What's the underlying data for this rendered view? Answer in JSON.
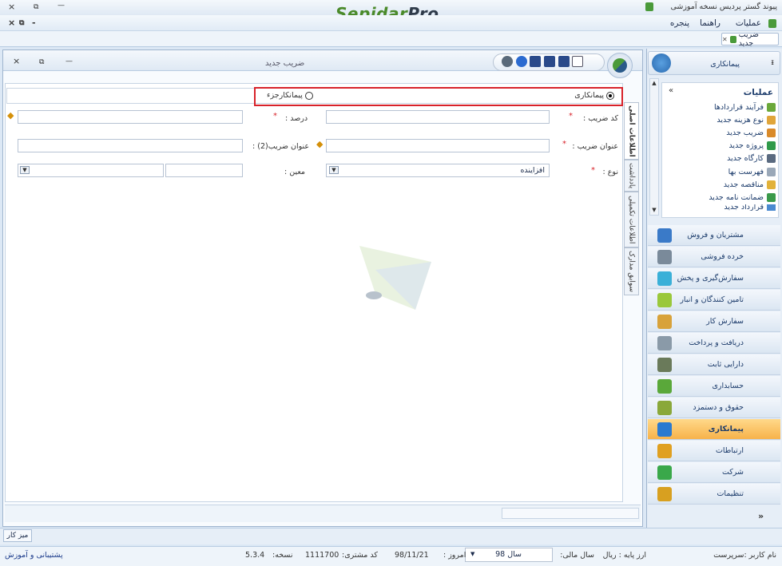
{
  "app": {
    "window_title": "پیوند گستر پردیس نسخه آموزشی",
    "logo_text": "Sepidar",
    "logo_suffix": "Pro",
    "close_glyph": "×",
    "restore_glyph": "⧉",
    "minimize_glyph": "—"
  },
  "menu": {
    "items": [
      "عملیات",
      "راهنما",
      "پنجره"
    ],
    "mdi_controls": [
      "×",
      "⧉",
      "-"
    ]
  },
  "open_tab": {
    "label": "ضریب جدید",
    "close_glyph": "✕"
  },
  "window": {
    "title": "ضریب جدید",
    "controls": [
      "×",
      "⧉",
      "—"
    ],
    "toolbar_icons": [
      "new-doc-icon",
      "save-icon",
      "save-as-icon",
      "save-close-icon",
      "help-icon",
      "print-icon"
    ]
  },
  "form": {
    "radio_contractor": "پیمانکاری",
    "radio_subcontractor": "پیمانکارجزء",
    "code_label": "کد ضریب :",
    "code_value": "",
    "percent_label": "درصد :",
    "percent_value": "",
    "title_label": "عنوان ضریب :",
    "title_value": "",
    "title2_label": "عنوان ضریب(2) :",
    "title2_value": "",
    "type_label": "نوع :",
    "type_value": "افزاینده",
    "moin_label": "معین :",
    "moin_value": "",
    "required_mark": "*"
  },
  "side_tabs": [
    "اطلاعات اصلی",
    "یادداشت",
    "اطلاعات تکمیلی",
    "سوابق مدارک"
  ],
  "sidebar": {
    "header": "پیمانکاری",
    "pin_glyph": "ᵻ",
    "ops_title": "عملیات",
    "ops_collapse": "«",
    "ops_items": [
      {
        "label": "فرآیند قراردادها",
        "icon": "process-icon",
        "color": "#6aa83a"
      },
      {
        "label": "نوع هزینه جدید",
        "icon": "cost-type-icon",
        "color": "#e0a53a"
      },
      {
        "label": "ضریب جدید",
        "icon": "percent-icon",
        "color": "#d98a2a"
      },
      {
        "label": "پروژه جدید",
        "icon": "project-icon",
        "color": "#2f9a4a"
      },
      {
        "label": "کارگاه جدید",
        "icon": "workshop-icon",
        "color": "#5a6a80"
      },
      {
        "label": "فهرست بها",
        "icon": "price-list-icon",
        "color": "#9aa8b8"
      },
      {
        "label": "مناقصه جدید",
        "icon": "tender-icon",
        "color": "#e2b23a"
      },
      {
        "label": "ضمانت نامه جدید",
        "icon": "guarantee-icon",
        "color": "#3a9a4a"
      },
      {
        "label": "قرارداد جدید",
        "icon": "contract-icon",
        "color": "#4a8ad0"
      }
    ],
    "modules": [
      {
        "label": "مشتریان و فروش",
        "icon": "customers-icon",
        "color": "#3a7ac8",
        "active": false
      },
      {
        "label": "خرده فروشی",
        "icon": "retail-icon",
        "color": "#7a8a9a",
        "active": false
      },
      {
        "label": "سفارش‌گیری و پخش",
        "icon": "order-icon",
        "color": "#3ab0d8",
        "active": false
      },
      {
        "label": "تامین کنندگان و انبار",
        "icon": "suppliers-icon",
        "color": "#9ac83a",
        "active": false
      },
      {
        "label": "سفارش کار",
        "icon": "work-order-icon",
        "color": "#d8a23a",
        "active": false
      },
      {
        "label": "دریافت و پرداخت",
        "icon": "payment-icon",
        "color": "#8a9aa8",
        "active": false
      },
      {
        "label": "دارایی ثابت",
        "icon": "fixed-asset-icon",
        "color": "#6a7a5a",
        "active": false
      },
      {
        "label": "حسابداری",
        "icon": "accounting-icon",
        "color": "#5aa83a",
        "active": false
      },
      {
        "label": "حقوق و دستمزد",
        "icon": "payroll-icon",
        "color": "#8aa83a",
        "active": false
      },
      {
        "label": "پیمانکاری",
        "icon": "contracting-icon",
        "color": "#2a7ad0",
        "active": true
      },
      {
        "label": "ارتباطات",
        "icon": "communications-icon",
        "color": "#e0a020",
        "active": false
      },
      {
        "label": "شرکت",
        "icon": "company-icon",
        "color": "#3aa84a",
        "active": false
      },
      {
        "label": "تنظیمات",
        "icon": "settings-icon",
        "color": "#d8a020",
        "active": false
      }
    ],
    "expand_glyph": "»"
  },
  "desk": {
    "label": "میز کار"
  },
  "statusbar": {
    "user": "نام کاربر :سرپرست",
    "base_currency": "ارز پایه :  ریال",
    "fiscal_year_label": "سال مالی:",
    "fiscal_year_value": "سال 98",
    "today_label": "امروز :",
    "today_value": "98/11/21",
    "customer_code_label": "کد مشتری:",
    "customer_code_value": "1111700",
    "version_label": "نسخه:",
    "version_value": "5.3.4",
    "support": "پشتیبانی و آموزش"
  }
}
